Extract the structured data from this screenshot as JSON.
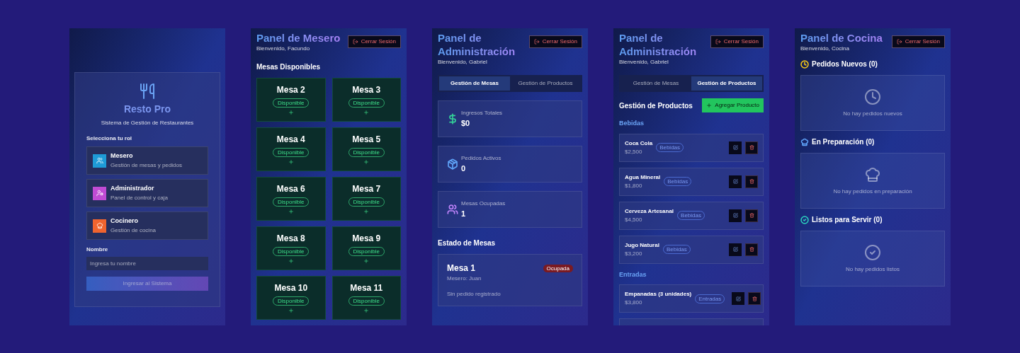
{
  "screens": [
    {
      "kind": "login",
      "app_name": "Resto Pro",
      "subtitle": "Sistema de Gestión de Restaurantes",
      "role_label": "Selecciona tu rol",
      "roles": [
        {
          "name": "Mesero",
          "description": "Gestión de mesas y pedidos",
          "color": "#1e9bd7",
          "selected": false
        },
        {
          "name": "Administrador",
          "description": "Panel de control y caja",
          "color": "#c04bd4",
          "selected": false
        },
        {
          "name": "Cocinero",
          "description": "Gestión de cocina",
          "color": "#f0642f",
          "selected": false
        }
      ],
      "name_label": "Nombre",
      "name_placeholder": "Ingresa tu nombre",
      "submit": "Ingresar al Sistema",
      "submit_disabled": true
    },
    {
      "kind": "waiter",
      "title": "Panel de Mesero",
      "welcome": "Bienvenido, Facundo",
      "logout": "Cerrar Sesión",
      "section": "Mesas Disponibles",
      "tables": [
        {
          "name": "Mesa 2",
          "status": "Disponible"
        },
        {
          "name": "Mesa 3",
          "status": "Disponible"
        },
        {
          "name": "Mesa 4",
          "status": "Disponible"
        },
        {
          "name": "Mesa 5",
          "status": "Disponible"
        },
        {
          "name": "Mesa 6",
          "status": "Disponible"
        },
        {
          "name": "Mesa 7",
          "status": "Disponible"
        },
        {
          "name": "Mesa 8",
          "status": "Disponible"
        },
        {
          "name": "Mesa 9",
          "status": "Disponible"
        },
        {
          "name": "Mesa 10",
          "status": "Disponible"
        },
        {
          "name": "Mesa 11",
          "status": "Disponible"
        }
      ]
    },
    {
      "kind": "admin_tables",
      "title": "Panel de Administración",
      "welcome": "Bienvenido, Gabriel",
      "logout": "Cerrar Sesión",
      "tabs": [
        {
          "label": "Gestión de Mesas",
          "selected": true
        },
        {
          "label": "Gestión de Productos",
          "selected": false
        }
      ],
      "stats": [
        {
          "label": "Ingresos Totales",
          "value": "$0",
          "color": "#34d399"
        },
        {
          "label": "Pedidos Activos",
          "value": "0",
          "color": "#60a5fa"
        },
        {
          "label": "Mesas Ocupadas",
          "value": "1",
          "color": "#c084fc"
        }
      ],
      "section": "Estado de Mesas",
      "tables": [
        {
          "name": "Mesa 1",
          "waiter": "Mesero: Juan",
          "status": "Ocupada",
          "note": "Sin pedido registrado"
        }
      ]
    },
    {
      "kind": "admin_products",
      "title": "Panel de Administración",
      "welcome": "Bienvenido, Gabriel",
      "logout": "Cerrar Sesión",
      "tabs": [
        {
          "label": "Gestión de Mesas",
          "selected": false
        },
        {
          "label": "Gestión de Productos",
          "selected": true
        }
      ],
      "section": "Gestión de Productos",
      "add_button": "Agregar Producto",
      "categories": [
        {
          "name": "Bebidas",
          "products": [
            {
              "name": "Coca Cola",
              "price": "$2,500",
              "tag": "Bebidas"
            },
            {
              "name": "Agua Mineral",
              "price": "$1,800",
              "tag": "Bebidas"
            },
            {
              "name": "Cerveza Artesanal",
              "price": "$4,500",
              "tag": "Bebidas"
            },
            {
              "name": "Jugo Natural",
              "price": "$3,200",
              "tag": "Bebidas"
            }
          ]
        },
        {
          "name": "Entradas",
          "products": [
            {
              "name": "Empanadas (3 unidades)",
              "price": "$3,800",
              "tag": "Entradas"
            }
          ]
        }
      ]
    },
    {
      "kind": "kitchen",
      "title": "Panel de Cocina",
      "welcome": "Bienvenido, Cocina",
      "logout": "Cerrar Sesión",
      "sections": [
        {
          "title": "Pedidos Nuevos (0)",
          "empty": "No hay pedidos nuevos",
          "color": "#facc15"
        },
        {
          "title": "En Preparación (0)",
          "empty": "No hay pedidos en preparación",
          "color": "#60a5fa"
        },
        {
          "title": "Listos para Servir (0)",
          "empty": "No hay pedidos listos",
          "color": "#2dd4bf"
        }
      ]
    }
  ]
}
